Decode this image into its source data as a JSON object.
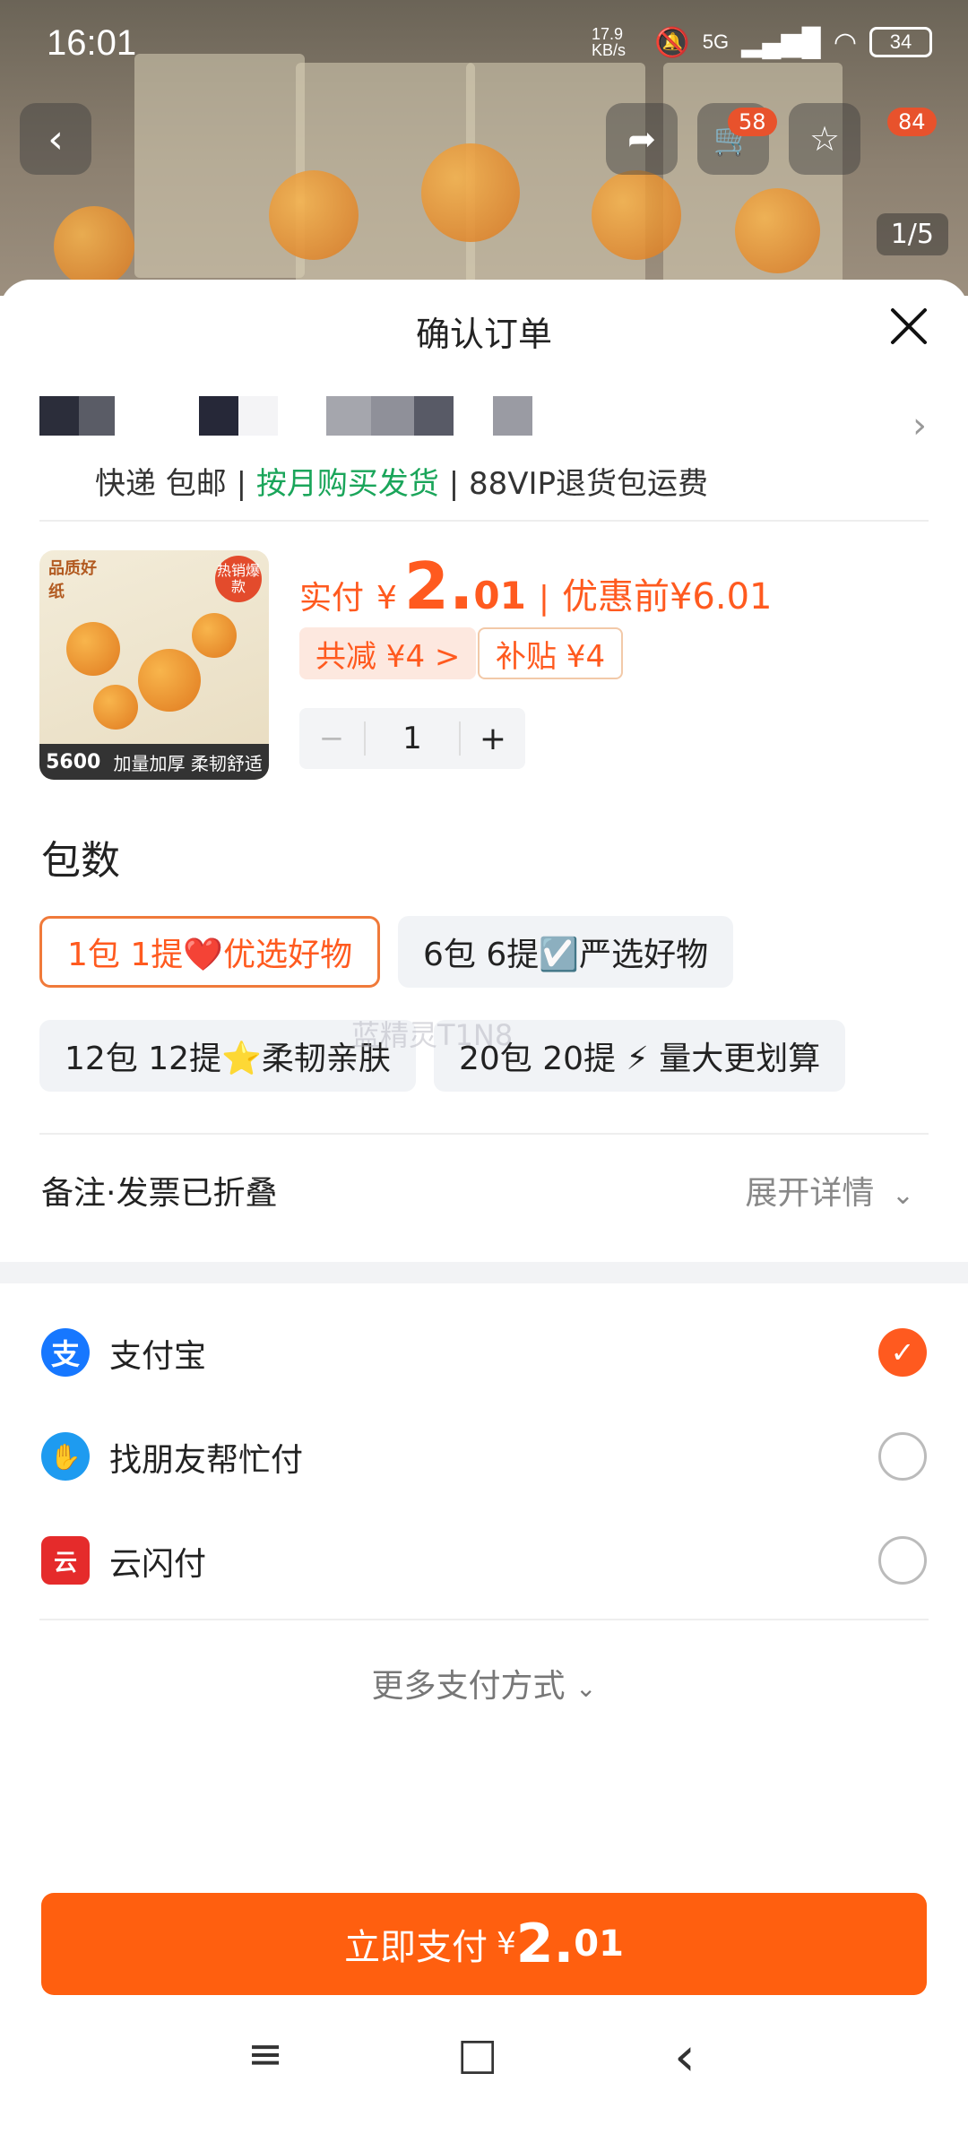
{
  "status_bar": {
    "time": "16:01",
    "net_speed": "17.9 KB/s",
    "network": "5G",
    "battery": "34"
  },
  "header": {
    "cart_badge": "58",
    "fav_badge": "84",
    "image_counter": "1/5"
  },
  "sheet": {
    "title": "确认订单",
    "shipping": {
      "prefix": "快递 包邮 | ",
      "green": "按月购买发货",
      "suffix": " | 88VIP退货包运费"
    },
    "product": {
      "thumb_title": "品质好纸",
      "thumb_hot": "热销爆款",
      "thumb_count": "5600",
      "thumb_caption": "加量加厚 柔韧舒适",
      "paid_label": "实付",
      "currency": "¥",
      "price_int": "2.",
      "price_dec": "01",
      "before_label": "优惠前",
      "before_price": "¥6.01",
      "discount_tag": "共减 ¥4 >",
      "subsidy_tag": "补贴 ¥4",
      "quantity": "1",
      "minus": "−",
      "plus": "+"
    },
    "spec": {
      "title": "包数",
      "options": [
        {
          "label": "1包 1提❤️优选好物",
          "selected": true
        },
        {
          "label": "6包 6提☑️严选好物",
          "selected": false
        },
        {
          "label": "12包 12提⭐柔韧亲肤",
          "selected": false
        },
        {
          "label": "20包 20提 ⚡ 量大更划算",
          "selected": false
        }
      ],
      "watermark": "蓝精灵T1N8"
    },
    "remark": {
      "label": "备注·发票已折叠",
      "expand": "展开详情"
    },
    "payments": [
      {
        "name": "支付宝",
        "icon": "alipay-icon",
        "icon_text": "支",
        "color": "#1677ff",
        "selected": true
      },
      {
        "name": "找朋友帮忙付",
        "icon": "friend-pay-icon",
        "icon_text": "✋",
        "color": "#1e9bf0",
        "selected": false
      },
      {
        "name": "云闪付",
        "icon": "unionpay-icon",
        "icon_text": "云",
        "color": "#e52b2b",
        "selected": false
      }
    ],
    "more_pay": "更多支付方式",
    "pay_button": {
      "label": "立即支付",
      "currency": "¥",
      "price_int": "2.",
      "price_dec": "01"
    }
  },
  "nav_bar": {
    "menu": "≡",
    "home": "□",
    "back": "‹"
  },
  "colors": {
    "accent": "#ff5f0f",
    "green": "#1aa55a"
  }
}
